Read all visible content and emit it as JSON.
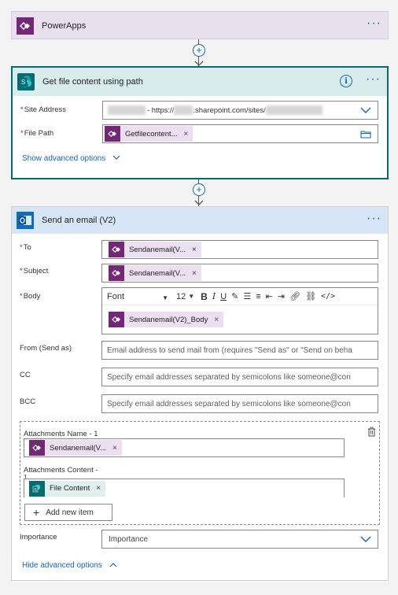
{
  "powerapps": {
    "title": "PowerApps",
    "more": "···"
  },
  "get_file": {
    "title": "Get file content using path",
    "more": "···",
    "info": "i",
    "fields": {
      "site_address": {
        "label": "Site Address",
        "value_prefix": "- https://",
        "value_mid": ".sharepoint.com/sites/"
      },
      "file_path": {
        "label": "File Path",
        "token": "Getfilecontent..."
      }
    },
    "advanced_link": "Show advanced options"
  },
  "send_email": {
    "title": "Send an email (V2)",
    "more": "···",
    "fields": {
      "to": {
        "label": "To",
        "token": "Sendanemail(V..."
      },
      "subject": {
        "label": "Subject",
        "token": "Sendanemail(V..."
      },
      "body": {
        "label": "Body",
        "font": "Font",
        "size": "12",
        "token": "Sendanemail(V2)_Body"
      },
      "from": {
        "label": "From (Send as)",
        "placeholder": "Email address to send mail from (requires \"Send as\" or \"Send on beha"
      },
      "cc": {
        "label": "CC",
        "placeholder": "Specify email addresses separated by semicolons like someone@con"
      },
      "bcc": {
        "label": "BCC",
        "placeholder": "Specify email addresses separated by semicolons like someone@con"
      },
      "attachments": {
        "name_label": "Attachments Name - 1",
        "name_token": "Sendanemail(V...",
        "content_label": "Attachments Content -",
        "content_label_2": "1",
        "content_token": "File Content",
        "add_button": "Add new item"
      },
      "importance": {
        "label": "Importance",
        "value": "Importance"
      }
    },
    "hide_link": "Hide advanced options"
  },
  "token_close": "×",
  "colors": {
    "powerapps_bg": "#e9e0ee",
    "powerapps_icon": "#742774",
    "sharepoint_header": "#d9ecec",
    "sharepoint_border": "#036c70",
    "outlook_header": "#d6e6f7",
    "outlook_icon": "#0f6cbd",
    "link": "#1464c0"
  }
}
